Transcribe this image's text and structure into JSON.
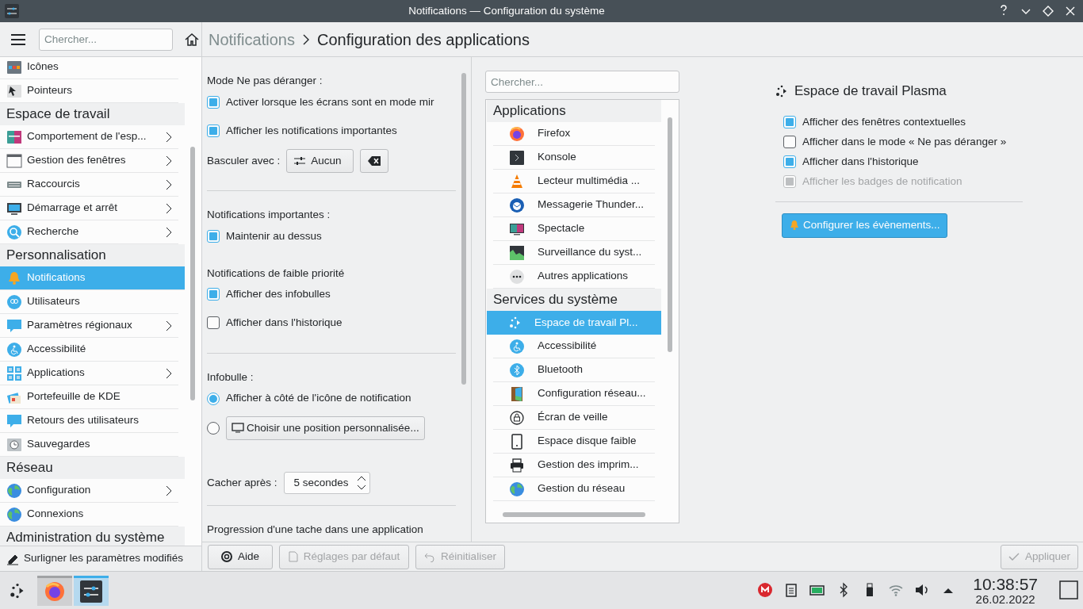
{
  "window": {
    "title": "Notifications — Configuration du système"
  },
  "sidebar": {
    "search_placeholder": "Chercher...",
    "entries": [
      {
        "kind": "module",
        "label": "Icônes",
        "has_children": false,
        "selected": false
      },
      {
        "kind": "module",
        "label": "Pointeurs",
        "has_children": false,
        "selected": false
      },
      {
        "kind": "category",
        "label": "Espace de travail"
      },
      {
        "kind": "module",
        "label": "Comportement de l'esp...",
        "has_children": true,
        "selected": false
      },
      {
        "kind": "module",
        "label": "Gestion des fenêtres",
        "has_children": true,
        "selected": false
      },
      {
        "kind": "module",
        "label": "Raccourcis",
        "has_children": true,
        "selected": false
      },
      {
        "kind": "module",
        "label": "Démarrage et arrêt",
        "has_children": true,
        "selected": false
      },
      {
        "kind": "module",
        "label": "Recherche",
        "has_children": true,
        "selected": false
      },
      {
        "kind": "category",
        "label": "Personnalisation"
      },
      {
        "kind": "module",
        "label": "Notifications",
        "has_children": false,
        "selected": true
      },
      {
        "kind": "module",
        "label": "Utilisateurs",
        "has_children": false,
        "selected": false
      },
      {
        "kind": "module",
        "label": "Paramètres régionaux",
        "has_children": true,
        "selected": false
      },
      {
        "kind": "module",
        "label": "Accessibilité",
        "has_children": false,
        "selected": false
      },
      {
        "kind": "module",
        "label": "Applications",
        "has_children": true,
        "selected": false
      },
      {
        "kind": "module",
        "label": "Portefeuille de KDE",
        "has_children": false,
        "selected": false
      },
      {
        "kind": "module",
        "label": "Retours des utilisateurs",
        "has_children": false,
        "selected": false
      },
      {
        "kind": "module",
        "label": "Sauvegardes",
        "has_children": false,
        "selected": false
      },
      {
        "kind": "category",
        "label": "Réseau"
      },
      {
        "kind": "module",
        "label": "Configuration",
        "has_children": true,
        "selected": false
      },
      {
        "kind": "module",
        "label": "Connexions",
        "has_children": false,
        "selected": false
      },
      {
        "kind": "category",
        "label": "Administration du système"
      }
    ],
    "footer_button": "Surligner les paramètres modifiés"
  },
  "breadcrumb": {
    "parent": "Notifications",
    "current": "Configuration des applications"
  },
  "settings": [
    [
      {
        "heading": "Mode Ne pas déranger :",
        "items": [
          {
            "kind": "checkbox",
            "label": "Activer lorsque les écrans sont en mode mir",
            "checked": true
          },
          {
            "kind": "checkbox",
            "label": "Afficher les notifications importantes",
            "checked": true
          },
          {
            "kind": "shortcut",
            "label": "Basculer avec :",
            "button": "Aucun"
          }
        ]
      }
    ],
    [
      {
        "heading": "Notifications importantes :",
        "items": [
          {
            "kind": "checkbox",
            "label": "Maintenir au dessus",
            "checked": true
          }
        ]
      },
      {
        "heading": "Notifications de faible priorité",
        "items": [
          {
            "kind": "checkbox",
            "label": "Afficher des infobulles",
            "checked": true
          },
          {
            "kind": "checkbox",
            "label": "Afficher dans l'historique",
            "checked": false
          }
        ]
      }
    ],
    [
      {
        "heading": "Infobulle :",
        "items": [
          {
            "kind": "radio",
            "label": "Afficher à côté de l'icône de notification",
            "selected": true
          },
          {
            "kind": "radio_button",
            "button": "Choisir une position personnalisée...",
            "selected": false
          },
          {
            "kind": "spin",
            "label": "Cacher après :",
            "value": "5 secondes"
          }
        ]
      }
    ],
    [
      {
        "heading": "Progression d'une tache dans une application"
      }
    ]
  ],
  "sources": {
    "search_placeholder": "Chercher...",
    "groups": [
      {
        "category": "Applications",
        "items": [
          {
            "name": "Firefox",
            "selected": false
          },
          {
            "name": "Konsole",
            "selected": false
          },
          {
            "name": "Lecteur multimédia ...",
            "selected": false
          },
          {
            "name": "Messagerie Thunder...",
            "selected": false
          },
          {
            "name": "Spectacle",
            "selected": false
          },
          {
            "name": "Surveillance du syst...",
            "selected": false
          },
          {
            "name": "Autres applications",
            "selected": false
          }
        ]
      },
      {
        "category": "Services du système",
        "items": [
          {
            "name": "Espace de travail Pl...",
            "selected": true
          },
          {
            "name": "Accessibilité",
            "selected": false
          },
          {
            "name": "Bluetooth",
            "selected": false
          },
          {
            "name": "Configuration réseau...",
            "selected": false
          },
          {
            "name": "Écran de veille",
            "selected": false
          },
          {
            "name": "Espace disque faible",
            "selected": false
          },
          {
            "name": "Gestion des imprim...",
            "selected": false
          },
          {
            "name": "Gestion du réseau",
            "selected": false
          }
        ]
      }
    ]
  },
  "detail": {
    "title": "Espace de travail Plasma",
    "options": [
      {
        "label": "Afficher des fenêtres contextuelles",
        "checked": true,
        "disabled": false
      },
      {
        "label": "Afficher dans le mode « Ne pas déranger »",
        "checked": false,
        "disabled": false
      },
      {
        "label": "Afficher dans l'historique",
        "checked": true,
        "disabled": false
      },
      {
        "label": "Afficher les badges de notification",
        "checked": true,
        "disabled": true
      }
    ],
    "button": "Configurer les évènements..."
  },
  "footer": {
    "buttons": [
      {
        "kind": "help",
        "label": "Aide",
        "disabled": false
      },
      {
        "kind": "defaults",
        "label": "Réglages par défaut",
        "disabled": true
      },
      {
        "kind": "reset",
        "label": "Réinitialiser",
        "disabled": true
      }
    ],
    "apply": {
      "label": "Appliquer",
      "disabled": true
    }
  },
  "taskbar": {
    "tasks": [
      {
        "kind": "browser",
        "selected": false
      },
      {
        "kind": "settings",
        "selected": true
      }
    ],
    "time": "10:38:57",
    "date": "26.02.2022"
  }
}
